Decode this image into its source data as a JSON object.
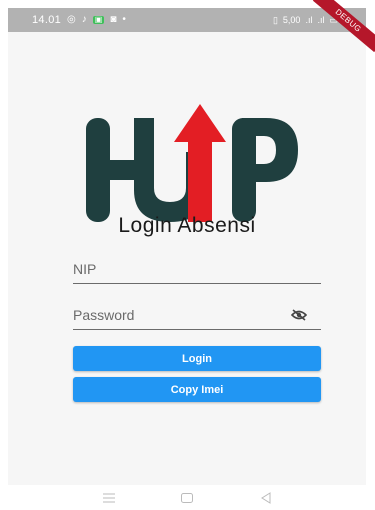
{
  "status_bar": {
    "time": "14.01",
    "network_speed": "5,00",
    "debug_label": "DEBUG"
  },
  "logo": {
    "text": "HUP",
    "colors": {
      "dark": "#1f3f3f",
      "accent": "#e31e24"
    }
  },
  "login": {
    "title": "Login Absensi",
    "nip_placeholder": "NIP",
    "password_placeholder": "Password",
    "login_label": "Login",
    "copy_imei_label": "Copy Imei"
  },
  "colors": {
    "primary_button": "#2196f3",
    "status_bar": "#b2b2b2"
  },
  "icons": {
    "password_toggle": "eye-off-icon",
    "nav_recent": "menu-icon",
    "nav_home": "square-icon",
    "nav_back": "back-triangle-icon"
  }
}
